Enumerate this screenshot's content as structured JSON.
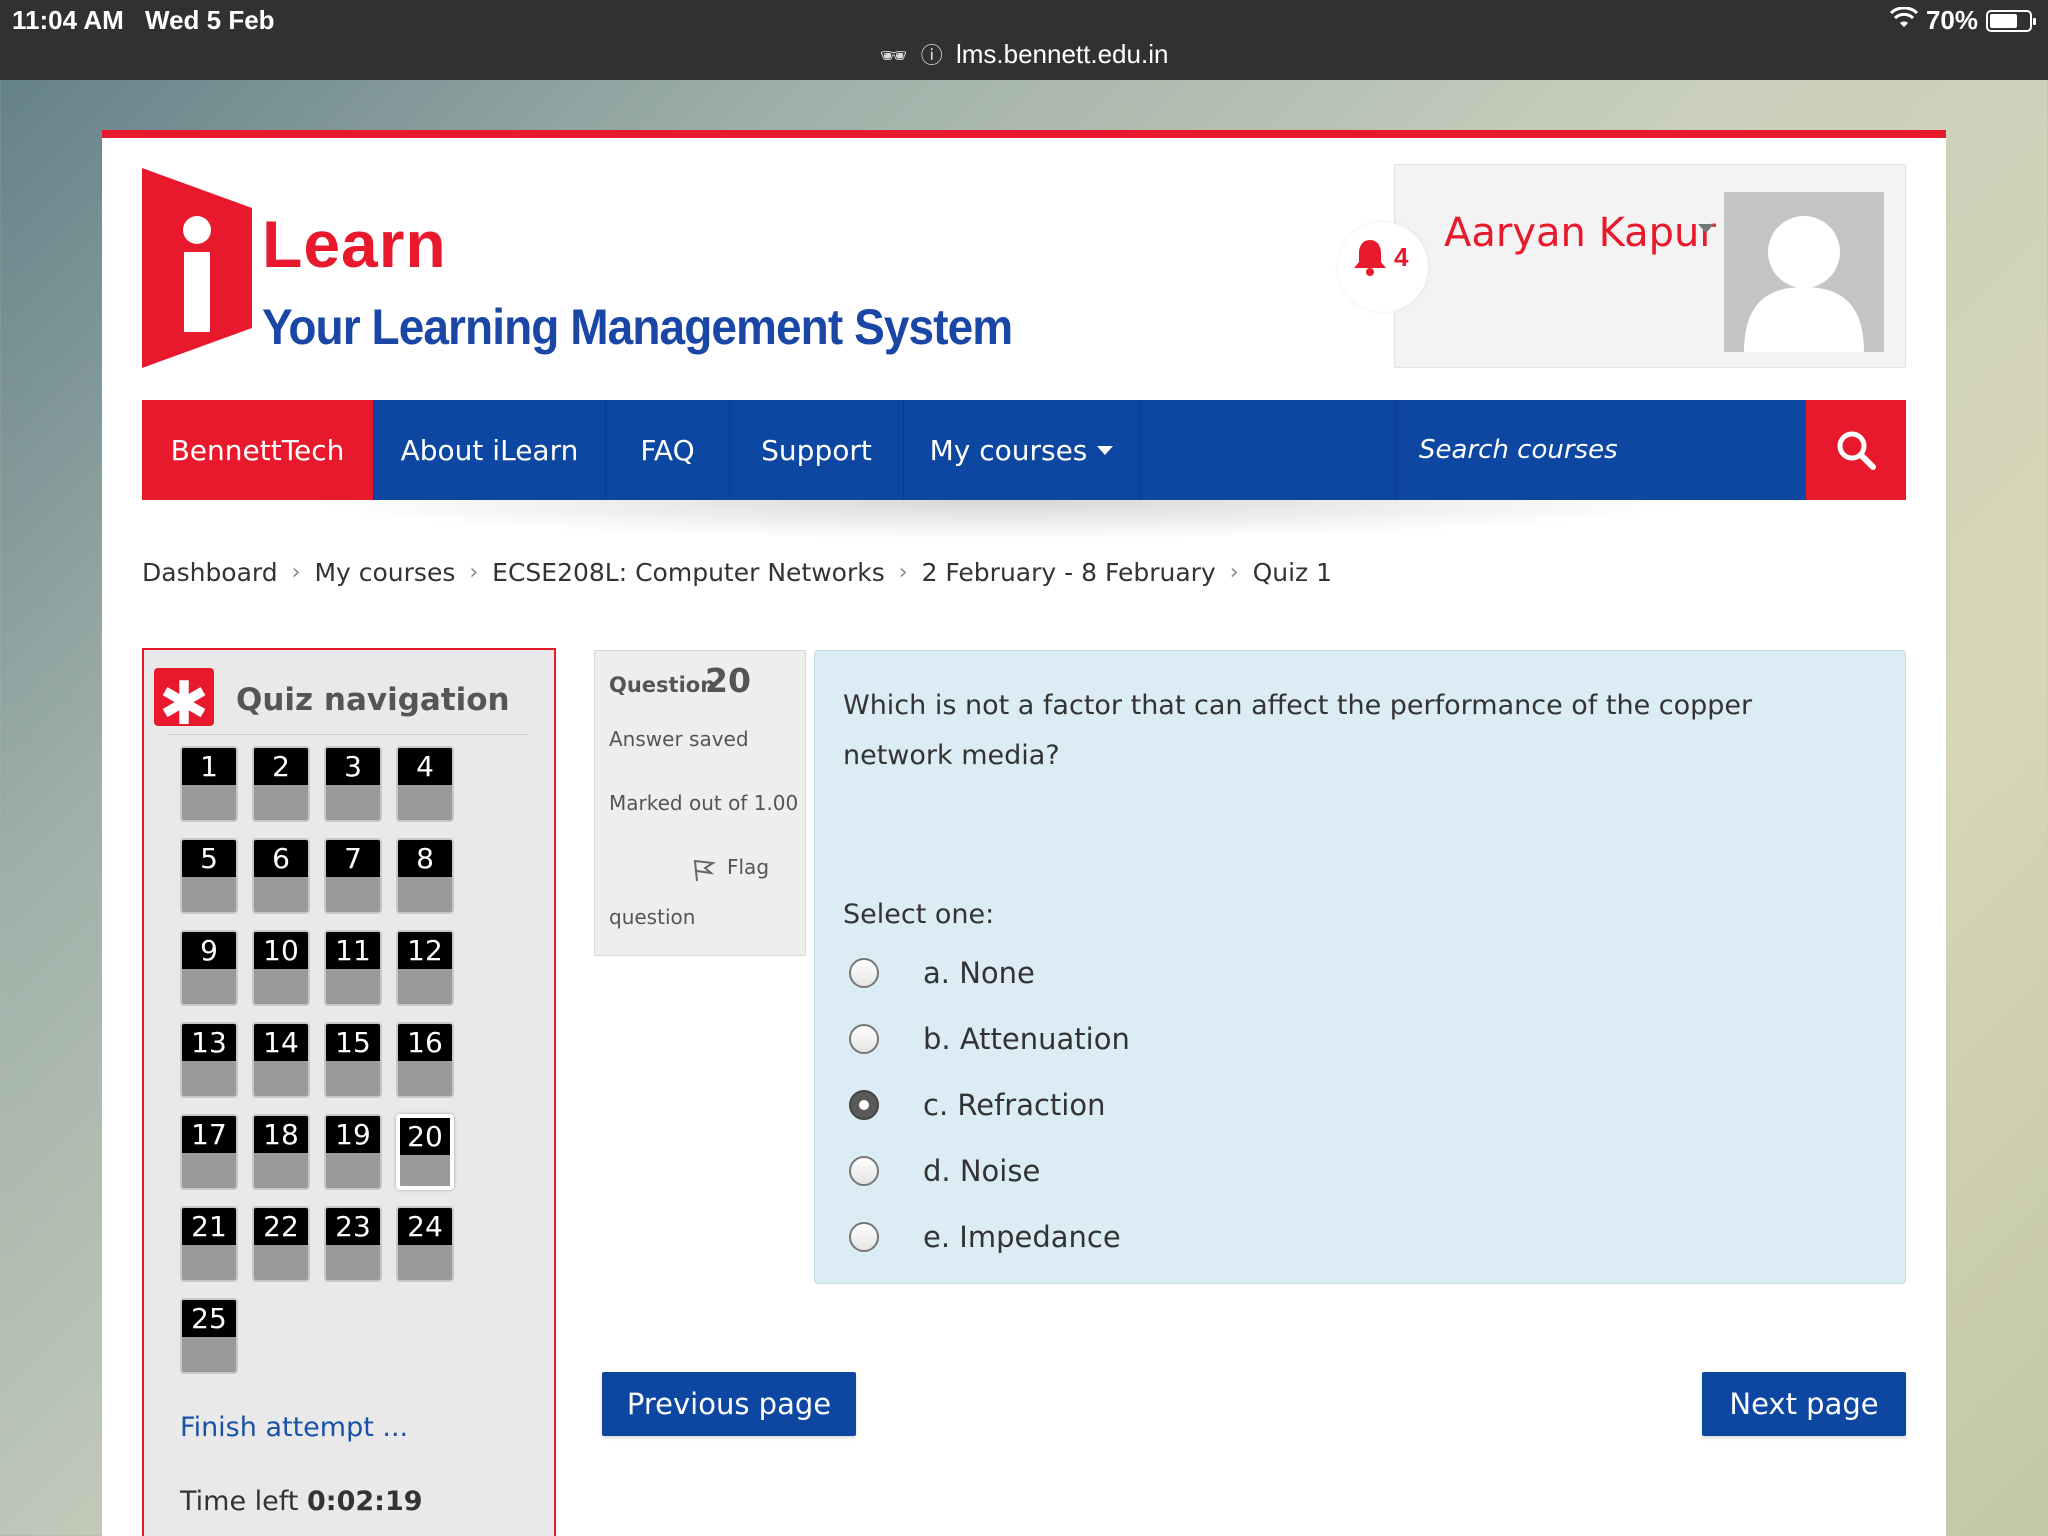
{
  "status_bar": {
    "time": "11:04 AM",
    "date": "Wed 5 Feb",
    "url": "lms.bennett.edu.in",
    "battery": "70%",
    "battery_level": 0.7
  },
  "header": {
    "logo_title": "Learn",
    "logo_tagline": "Your Learning Management System",
    "notification_count": "4",
    "user_name": "Aaryan Kapur"
  },
  "nav": {
    "items": [
      "BennettTech",
      "About iLearn",
      "FAQ",
      "Support",
      "My courses"
    ],
    "search_placeholder": "Search courses"
  },
  "breadcrumb": [
    "Dashboard",
    "My courses",
    "ECSE208L: Computer Networks",
    "2 February - 8 February",
    "Quiz 1"
  ],
  "quiz_nav": {
    "title": "Quiz navigation",
    "questions": [
      "1",
      "2",
      "3",
      "4",
      "5",
      "6",
      "7",
      "8",
      "9",
      "10",
      "11",
      "12",
      "13",
      "14",
      "15",
      "16",
      "17",
      "18",
      "19",
      "20",
      "21",
      "22",
      "23",
      "24",
      "25"
    ],
    "current": "20",
    "finish_label": "Finish attempt ...",
    "time_left_label": "Time left",
    "time_left_value": "0:02:19"
  },
  "question_info": {
    "label": "Question",
    "number": "20",
    "status": "Answer saved",
    "marked": "Marked out of 1.00",
    "flag_label_1": "Flag",
    "flag_label_2": "question"
  },
  "question": {
    "text": "Which is not a factor that can affect the performance of the copper network media?",
    "select_label": "Select one:",
    "options": [
      "a. None",
      "b. Attenuation",
      "c. Refraction",
      "d. Noise",
      "e. Impedance"
    ],
    "selected": "c. Refraction"
  },
  "buttons": {
    "previous": "Previous page",
    "next": "Next page"
  },
  "colors": {
    "accent_red": "#e8192c",
    "nav_blue": "#0d47a1",
    "question_bg": "#dbecf5"
  }
}
